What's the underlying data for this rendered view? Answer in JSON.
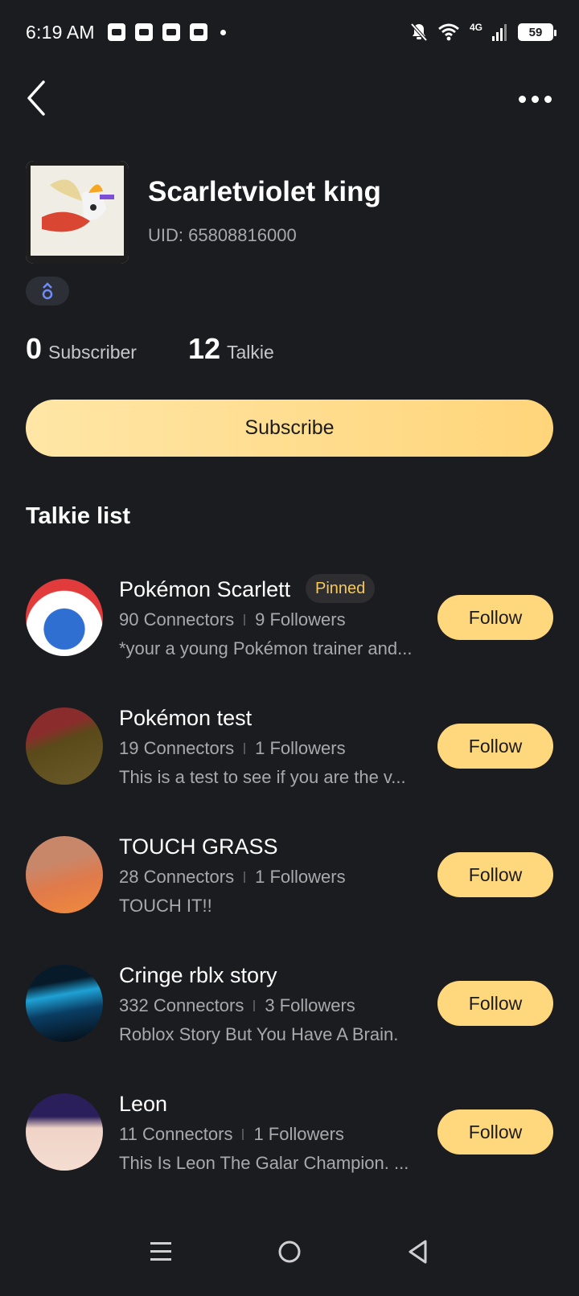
{
  "status_bar": {
    "time": "6:19 AM",
    "network": "4G",
    "battery": "59"
  },
  "profile": {
    "name": "Scarletviolet king",
    "uid": "UID: 65808816000",
    "subscriber_count": "0",
    "subscriber_label": "Subscriber",
    "talkie_count": "12",
    "talkie_label": "Talkie",
    "subscribe_label": "Subscribe"
  },
  "section_title": "Talkie list",
  "talkies": [
    {
      "name": "Pokémon Scarlett",
      "pinned": "Pinned",
      "connectors": "90 Connectors",
      "followers": "9 Followers",
      "desc": "*your a young Pokémon trainer and...",
      "follow": "Follow",
      "color1": "#ffffff",
      "color2": "#2f6fd2"
    },
    {
      "name": "Pokémon test",
      "pinned": "",
      "connectors": "19 Connectors",
      "followers": "1 Followers",
      "desc": "This is a test to see if you are the v...",
      "follow": "Follow",
      "color1": "#8b2c2c",
      "color2": "#7a6414"
    },
    {
      "name": "TOUCH GRASS",
      "pinned": "",
      "connectors": "28 Connectors",
      "followers": "1 Followers",
      "desc": "TOUCH IT!!",
      "follow": "Follow",
      "color1": "#c9876a",
      "color2": "#e87b3c"
    },
    {
      "name": "Cringe rblx story",
      "pinned": "",
      "connectors": "332 Connectors",
      "followers": "3 Followers",
      "desc": "Roblox Story But You Have A Brain.",
      "follow": "Follow",
      "color1": "#0a3d63",
      "color2": "#1fa1d4"
    },
    {
      "name": "Leon",
      "pinned": "",
      "connectors": "11 Connectors",
      "followers": "1 Followers",
      "desc": "This Is Leon The Galar Champion. ...",
      "follow": "Follow",
      "color1": "#3a2b6b",
      "color2": "#f0d3c6"
    }
  ]
}
